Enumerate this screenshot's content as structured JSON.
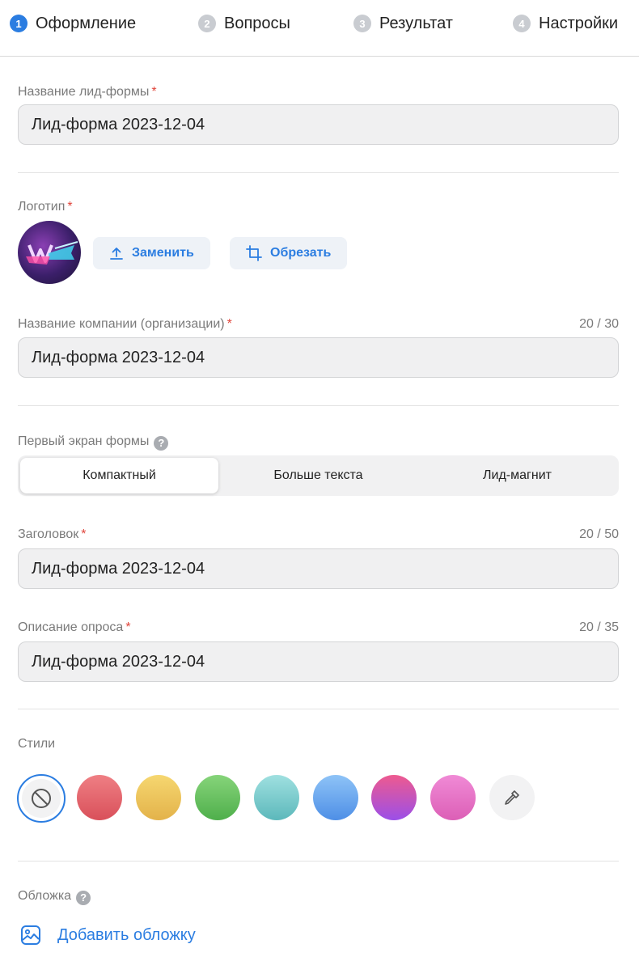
{
  "steps": [
    {
      "num": "1",
      "label": "Оформление",
      "active": true
    },
    {
      "num": "2",
      "label": "Вопросы",
      "active": false
    },
    {
      "num": "3",
      "label": "Результат",
      "active": false
    },
    {
      "num": "4",
      "label": "Настройки",
      "active": false
    }
  ],
  "form_name": {
    "label": "Название лид-формы",
    "required_mark": "*",
    "value": "Лид-форма 2023-12-04"
  },
  "logo": {
    "label": "Логотип",
    "required_mark": "*",
    "replace_label": "Заменить",
    "crop_label": "Обрезать"
  },
  "company_name": {
    "label": "Название компании (организации)",
    "required_mark": "*",
    "counter": "20 / 30",
    "value": "Лид-форма 2023-12-04"
  },
  "first_screen": {
    "label": "Первый экран формы",
    "help": "?",
    "options": [
      "Компактный",
      "Больше текста",
      "Лид-магнит"
    ],
    "selected": "Компактный"
  },
  "heading": {
    "label": "Заголовок",
    "required_mark": "*",
    "counter": "20 / 50",
    "value": "Лид-форма 2023-12-04"
  },
  "description": {
    "label": "Описание опроса",
    "required_mark": "*",
    "counter": "20 / 35",
    "value": "Лид-форма 2023-12-04"
  },
  "styles": {
    "label": "Стили",
    "selected": "none",
    "swatches": [
      {
        "name": "red",
        "top": "#ef7f84",
        "bottom": "#d9505a"
      },
      {
        "name": "yellow",
        "top": "#f6d770",
        "bottom": "#e3b24a"
      },
      {
        "name": "green",
        "top": "#86d47a",
        "bottom": "#4faf4b"
      },
      {
        "name": "teal",
        "top": "#9fe0e0",
        "bottom": "#5cb8bb"
      },
      {
        "name": "blue",
        "top": "#8ec3f7",
        "bottom": "#4e8fe6"
      },
      {
        "name": "purple",
        "top": "#ee5a8f",
        "bottom": "#9b4fe8"
      },
      {
        "name": "pink",
        "top": "#f08ad6",
        "bottom": "#dc5fb6"
      }
    ]
  },
  "cover": {
    "label": "Обложка",
    "help": "?",
    "add_label": "Добавить обложку"
  },
  "colors": {
    "accent": "#2b7de1",
    "required": "#e0443a"
  }
}
